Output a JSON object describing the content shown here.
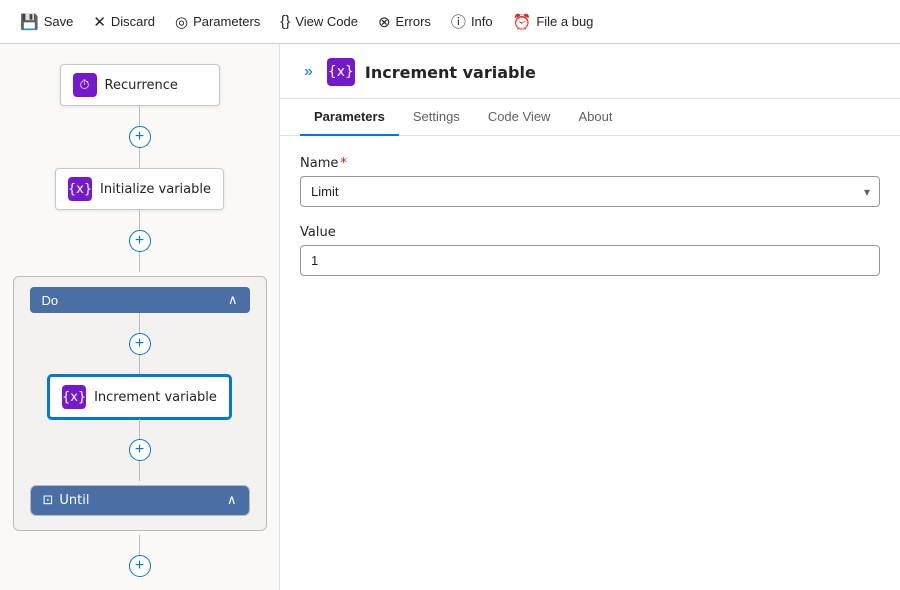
{
  "toolbar": {
    "save_label": "Save",
    "discard_label": "Discard",
    "parameters_label": "Parameters",
    "view_code_label": "View Code",
    "errors_label": "Errors",
    "info_label": "Info",
    "file_a_bug_label": "File a bug"
  },
  "canvas": {
    "chevron": "»",
    "recurrence_label": "Recurrence",
    "initialize_variable_label": "Initialize variable",
    "do_label": "Do",
    "increment_variable_label": "Increment variable",
    "until_label": "Until"
  },
  "detail_panel": {
    "title": "Increment variable",
    "tabs": [
      "Parameters",
      "Settings",
      "Code View",
      "About"
    ],
    "active_tab": "Parameters",
    "name_label": "Name",
    "name_required": "*",
    "name_value": "Limit",
    "name_options": [
      "Limit"
    ],
    "value_label": "Value",
    "value_value": "1"
  }
}
